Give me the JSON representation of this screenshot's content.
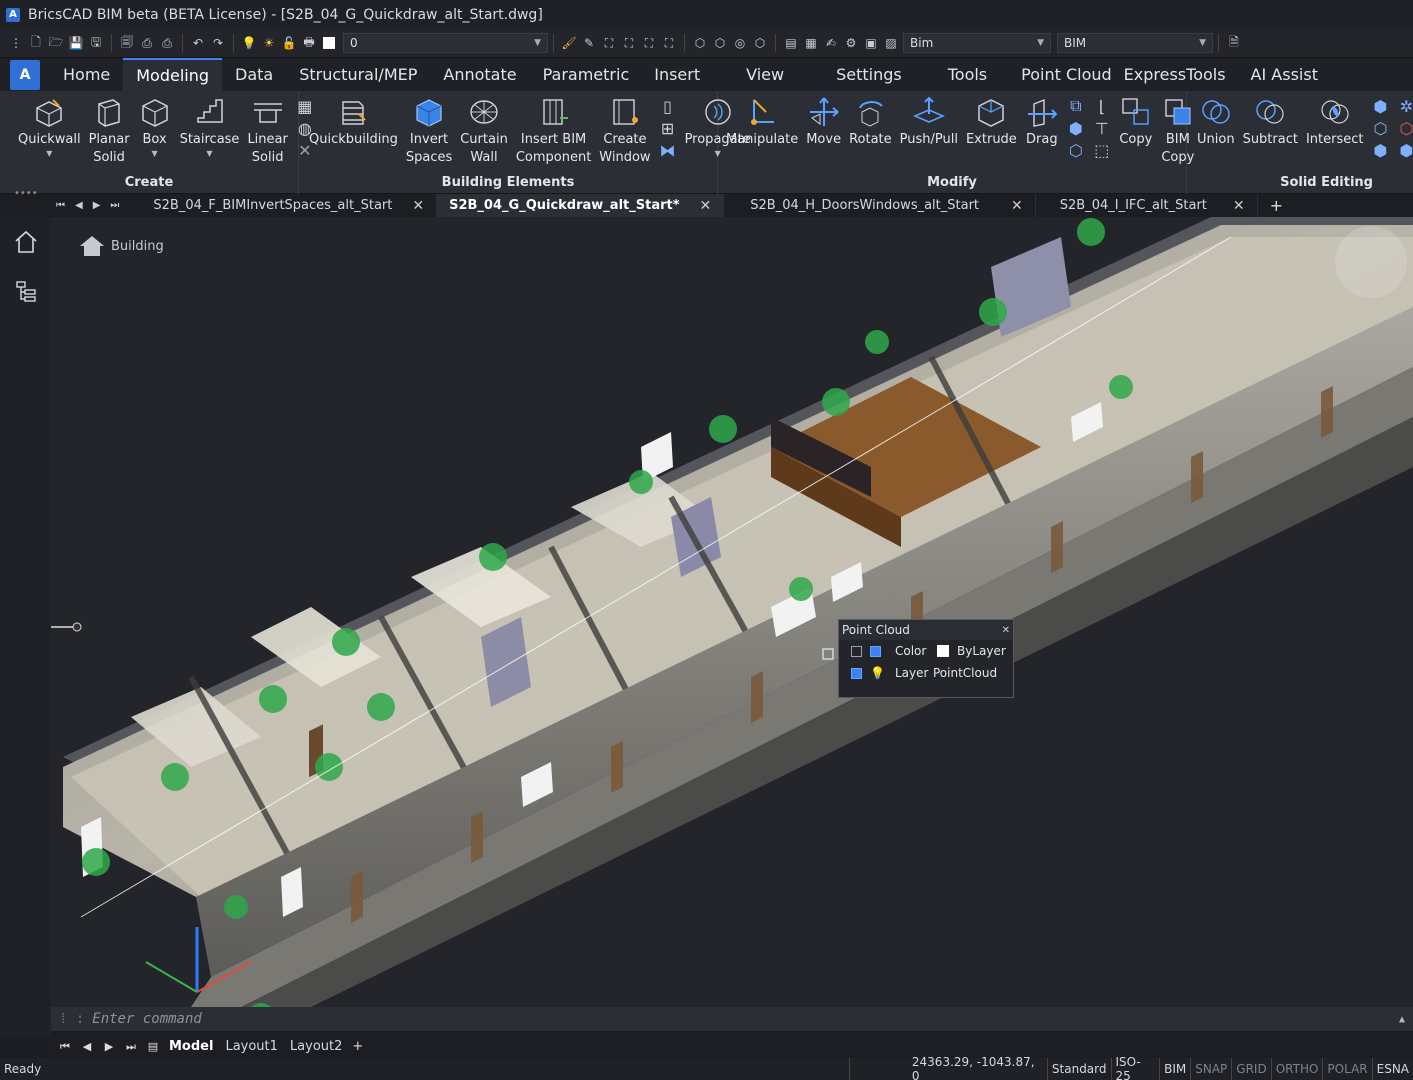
{
  "window": {
    "title": "BricsCAD BIM beta (BETA License) - [S2B_04_G_Quickdraw_alt_Start.dwg]"
  },
  "qat": {
    "layer_value": "0",
    "workspace_value": "Bim",
    "profile_value": "BIM"
  },
  "ribbon_tabs": [
    "Home",
    "Modeling",
    "Data",
    "Structural/MEP",
    "Annotate",
    "Parametric",
    "Insert",
    "View",
    "Settings",
    "Tools",
    "Point Cloud",
    "ExpressTools",
    "AI Assist"
  ],
  "ribbon": {
    "create": {
      "title": "Create",
      "quickwall": "Quickwall",
      "planar_solid_1": "Planar",
      "planar_solid_2": "Solid",
      "box": "Box",
      "staircase": "Staircase",
      "linear_solid_1": "Linear",
      "linear_solid_2": "Solid"
    },
    "building": {
      "title": "Building Elements",
      "quickbuilding": "Quickbuilding",
      "invert_1": "Invert",
      "invert_2": "Spaces",
      "curtain_1": "Curtain",
      "curtain_2": "Wall",
      "insert_1": "Insert BIM",
      "insert_2": "Component",
      "create_1": "Create",
      "create_2": "Window",
      "propagate": "Propagate"
    },
    "modify": {
      "title": "Modify",
      "manipulate": "Manipulate",
      "move": "Move",
      "rotate": "Rotate",
      "pushpull": "Push/Pull",
      "extrude": "Extrude",
      "drag": "Drag",
      "copy": "Copy",
      "bimcopy_1": "BIM",
      "bimcopy_2": "Copy"
    },
    "solid": {
      "title": "Solid Editing",
      "union": "Union",
      "subtract": "Subtract",
      "intersect": "Intersect"
    }
  },
  "doc_tabs": [
    {
      "label": "S2B_04_F_BIMInvertSpaces_alt_Start"
    },
    {
      "label": "S2B_04_G_Quickdraw_alt_Start*"
    },
    {
      "label": "S2B_04_H_DoorsWindows_alt_Start"
    },
    {
      "label": "S2B_04_I_IFC_alt_Start"
    }
  ],
  "viewport": {
    "breadcrumb": "Building"
  },
  "point_cloud_panel": {
    "title": "Point Cloud",
    "color_label": "Color",
    "color_value": "ByLayer",
    "layer_label": "Layer",
    "layer_value": "PointCloud"
  },
  "command": {
    "placeholder": "Enter command"
  },
  "layout_tabs": {
    "model": "Model",
    "layout1": "Layout1",
    "layout2": "Layout2"
  },
  "status": {
    "ready": "Ready",
    "coords": "24363.29, -1043.87, 0",
    "style": "Standard",
    "dimstyle": "ISO-25",
    "workspace": "BIM",
    "snap": "SNAP",
    "grid": "GRID",
    "ortho": "ORTHO",
    "polar": "POLAR",
    "esnap": "ESNA"
  },
  "colors": {
    "accent": "#3b82f6",
    "app_blue": "#2f6fd6"
  }
}
